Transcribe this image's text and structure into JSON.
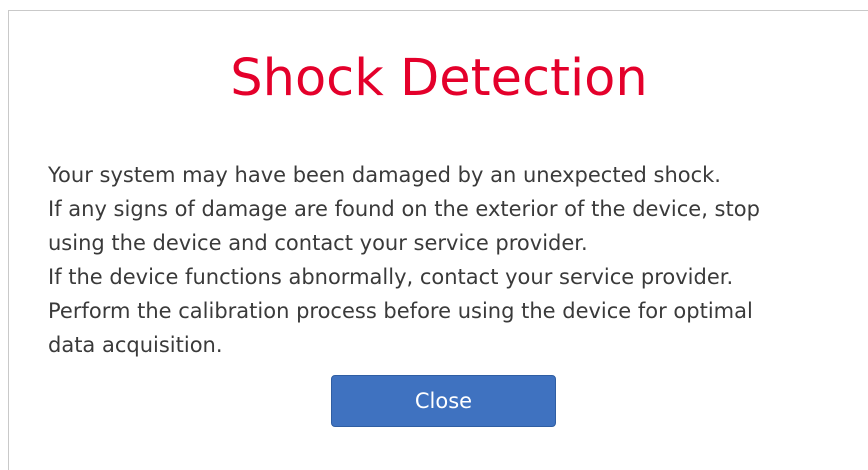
{
  "dialog": {
    "title": "Shock Detection",
    "message_lines": [
      "Your system may have been damaged by an unexpected shock.",
      "If any signs of damage are found on the exterior of the device, stop",
      "using the device and contact your service provider.",
      "If the device functions abnormally, contact your service provider.",
      "Perform the calibration process before using the device for optimal",
      "data acquisition."
    ],
    "close_label": "Close"
  },
  "colors": {
    "title": "#e4002b",
    "button": "#3f72c0",
    "text": "#3a3a3a"
  }
}
